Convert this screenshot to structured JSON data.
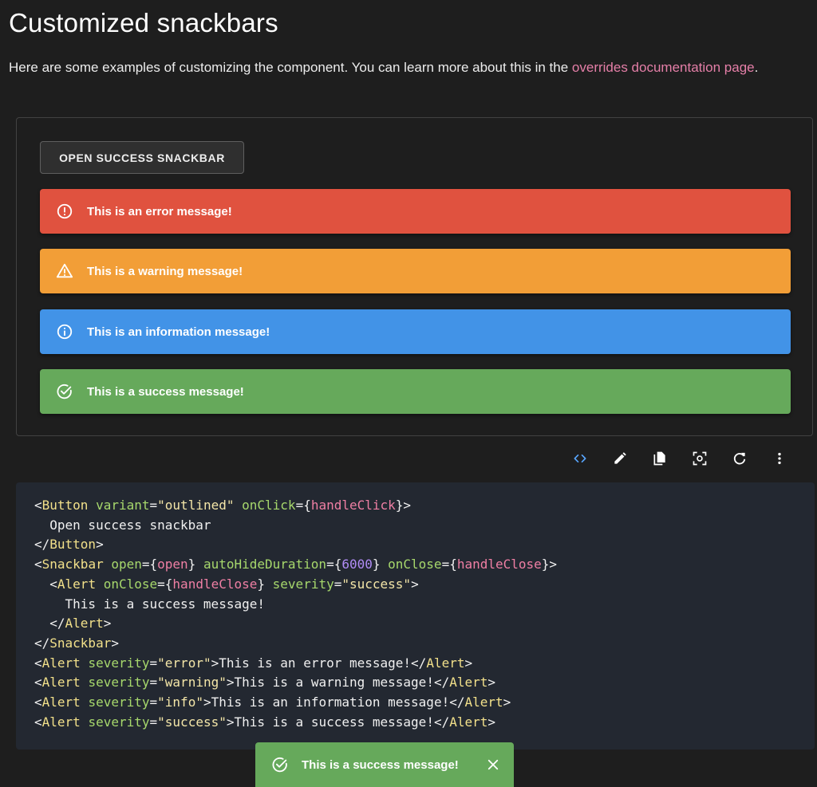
{
  "page": {
    "title": "Customized snackbars",
    "intro_text": "Here are some examples of customizing the component. You can learn more about this in the ",
    "intro_link": "overrides documentation page",
    "intro_end": "."
  },
  "demo": {
    "open_button_label": "OPEN SUCCESS SNACKBAR",
    "alerts": [
      {
        "severity": "error",
        "message": "This is an error message!",
        "color": "#e0523f",
        "icon": "error-outline-icon"
      },
      {
        "severity": "warning",
        "message": "This is a warning message!",
        "color": "#f29e37",
        "icon": "warning-amber-icon"
      },
      {
        "severity": "info",
        "message": "This is an information message!",
        "color": "#4293e7",
        "icon": "info-outline-icon"
      },
      {
        "severity": "success",
        "message": "This is a success message!",
        "color": "#66a95b",
        "icon": "check-circle-outline-icon"
      }
    ]
  },
  "toolbar": {
    "buttons": [
      "code-icon",
      "edit-icon",
      "copy-icon",
      "screenshot-icon",
      "refresh-icon",
      "more-vert-icon"
    ],
    "accent": "#58a6ff"
  },
  "code": {
    "lines": [
      "<Button variant=\"outlined\" onClick={handleClick}>",
      "  Open success snackbar",
      "</Button>",
      "<Snackbar open={open} autoHideDuration={6000} onClose={handleClose}>",
      "  <Alert onClose={handleClose} severity=\"success\">",
      "    This is a success message!",
      "  </Alert>",
      "</Snackbar>",
      "<Alert severity=\"error\">This is an error message!</Alert>",
      "<Alert severity=\"warning\">This is a warning message!</Alert>",
      "<Alert severity=\"info\">This is an information message!</Alert>",
      "<Alert severity=\"success\">This is a success message!</Alert>"
    ]
  },
  "snackbar": {
    "message": "This is a success message!",
    "color": "#66a95b",
    "icon": "check-circle-outline-icon",
    "close_icon": "close-icon"
  }
}
